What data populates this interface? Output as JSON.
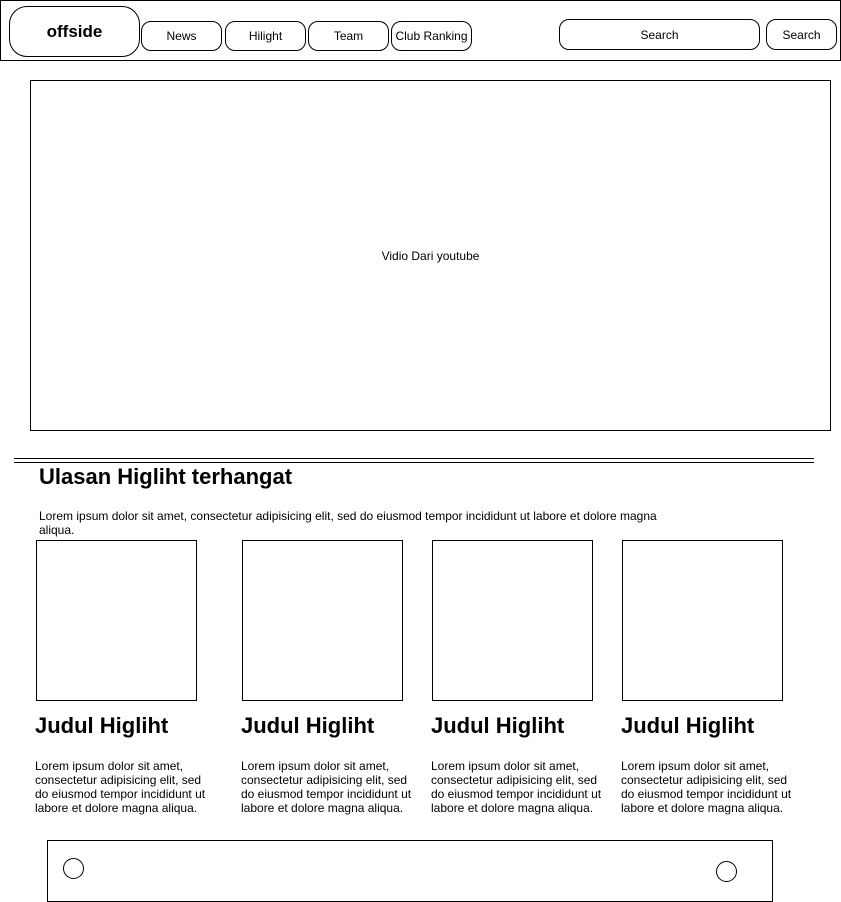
{
  "header": {
    "logo": "offside",
    "nav": [
      {
        "label": "News"
      },
      {
        "label": "Hilight"
      },
      {
        "label": "Team"
      },
      {
        "label": "Club Ranking"
      }
    ],
    "search": {
      "placeholder": "Search",
      "button_label": "Search"
    }
  },
  "video": {
    "label": "Vidio Dari youtube"
  },
  "highlights": {
    "title": "Ulasan Higliht terhangat",
    "description": "Lorem ipsum dolor sit amet, consectetur adipisicing elit, sed do eiusmod tempor incididunt ut labore et dolore magna aliqua.",
    "cards": [
      {
        "title": "Judul Higliht",
        "text": "Lorem ipsum dolor sit amet, consectetur adipisicing elit, sed do eiusmod tempor incididunt ut labore et dolore magna aliqua."
      },
      {
        "title": "Judul Higliht",
        "text": "Lorem ipsum dolor sit amet, consectetur adipisicing elit, sed do eiusmod tempor incididunt ut labore et dolore magna aliqua."
      },
      {
        "title": "Judul Higliht",
        "text": "Lorem ipsum dolor sit amet, consectetur adipisicing elit, sed do eiusmod tempor incididunt ut labore et dolore magna aliqua."
      },
      {
        "title": "Judul Higliht",
        "text": "Lorem ipsum dolor sit amet, consectetur adipisicing elit, sed do eiusmod tempor incididunt ut labore et dolore magna aliqua."
      }
    ]
  }
}
